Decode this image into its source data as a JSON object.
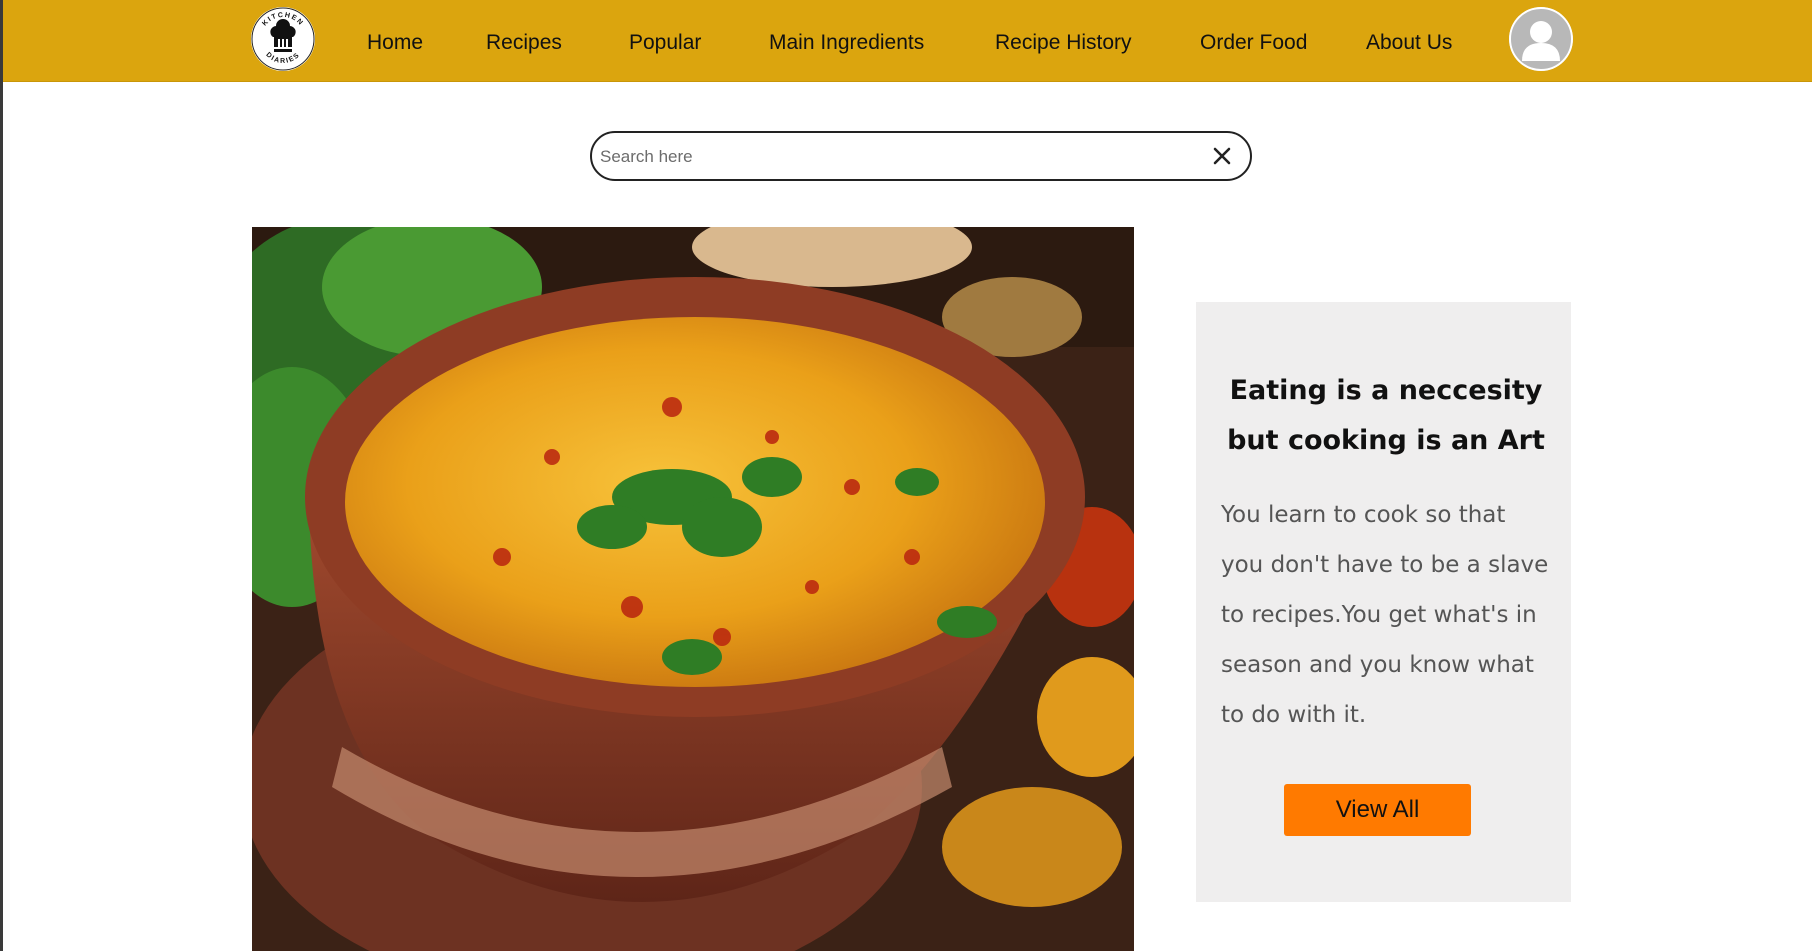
{
  "brand": {
    "logo_icon": "chef-hat-logo",
    "logo_text_top": "KITCHEN",
    "logo_text_bottom": "DIARIES"
  },
  "nav": {
    "items": [
      {
        "label": "Home"
      },
      {
        "label": "Recipes"
      },
      {
        "label": "Popular"
      },
      {
        "label": "Main Ingredients"
      },
      {
        "label": "Recipe History"
      },
      {
        "label": "Order Food"
      },
      {
        "label": "About Us"
      }
    ],
    "avatar_icon": "user-avatar-icon"
  },
  "search": {
    "placeholder": "Search here",
    "value": "",
    "clear_icon": "close-icon"
  },
  "hero": {
    "image_alt": "Bowl of yellow lentil dal topped with cilantro"
  },
  "card": {
    "heading": "Eating is a neccesity but cooking is an Art",
    "body": "You learn to cook so that you don't have to be a slave to recipes.You get what's in season and you know what to do with it.",
    "button_label": "View All"
  },
  "colors": {
    "navbar": "#dba50e",
    "button": "#ff7a00",
    "card_bg": "#efeeee"
  }
}
